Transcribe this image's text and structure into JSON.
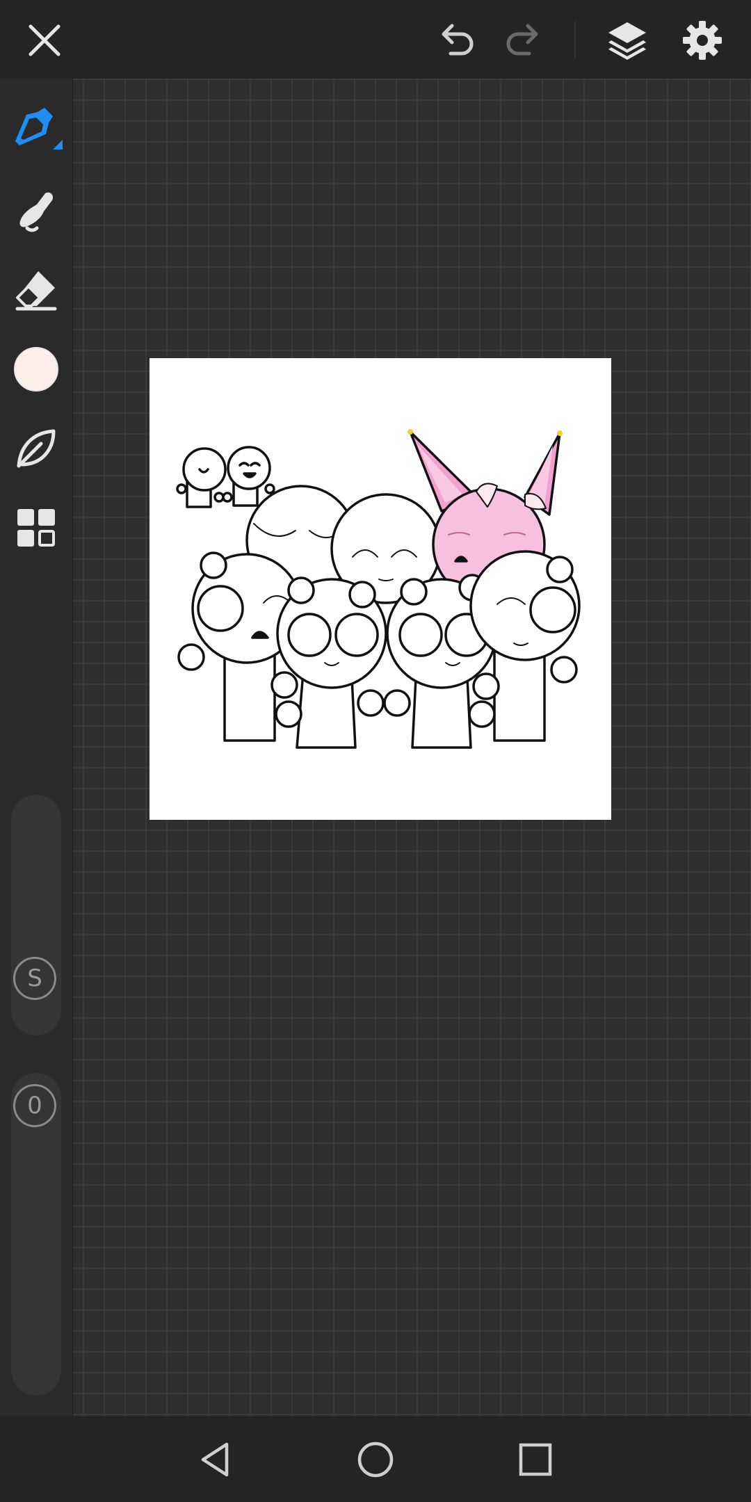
{
  "topbar": {
    "close": "close-icon",
    "undo": "undo-icon",
    "redo": "redo-icon",
    "layers": "layers-icon",
    "settings": "gear-icon"
  },
  "tools": [
    {
      "name": "pen-tool",
      "icon": "pen-icon",
      "active": true
    },
    {
      "name": "smudge-tool",
      "icon": "smudge-icon",
      "active": false
    },
    {
      "name": "eraser-tool",
      "icon": "eraser-icon",
      "active": false
    },
    {
      "name": "color-picker",
      "icon": "color-swatch",
      "active": false
    },
    {
      "name": "brush-select",
      "icon": "leaf-icon",
      "active": false
    },
    {
      "name": "more-tools",
      "icon": "grid-icon",
      "active": false
    }
  ],
  "colors": {
    "accent": "#1e8ef0",
    "current_color": "#fdeeea",
    "toolbar_bg": "#242424",
    "workspace_bg": "#2e2e2e"
  },
  "sliders": {
    "size_label": "S",
    "opacity_label": "0"
  },
  "navigation": {
    "back": "back-triangle-icon",
    "home": "home-circle-icon",
    "recents": "recents-square-icon"
  }
}
